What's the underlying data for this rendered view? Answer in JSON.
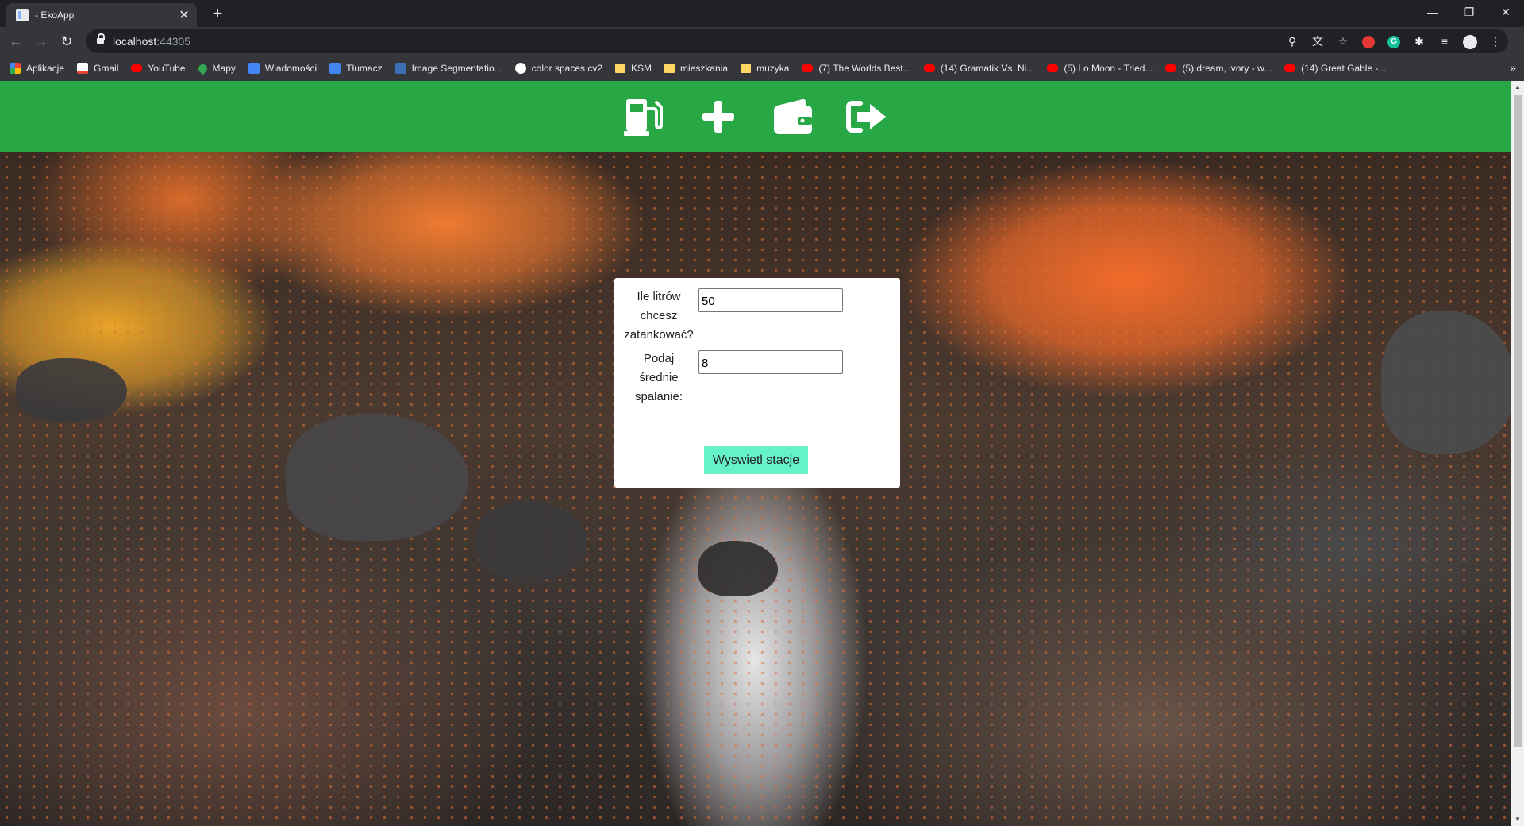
{
  "browser": {
    "tab_title": "- EkoApp",
    "tab_close": "✕",
    "new_tab": "+",
    "url_host": "localhost",
    "url_port": ":44305",
    "window_controls": {
      "minimize": "—",
      "restore": "❐",
      "close": "✕"
    },
    "nav": {
      "back": "←",
      "forward": "→",
      "reload": "↻"
    },
    "omnibox_icons": {
      "location": "⚲",
      "translate": "文",
      "star": "☆",
      "grammarly": "G",
      "puzzle": "✱",
      "media": "≡",
      "menu": "⋮"
    },
    "bookmarks": [
      {
        "label": "Aplikacje",
        "icon": "apps"
      },
      {
        "label": "Gmail",
        "icon": "gmail"
      },
      {
        "label": "YouTube",
        "icon": "yt"
      },
      {
        "label": "Mapy",
        "icon": "maps"
      },
      {
        "label": "Wiadomości",
        "icon": "news"
      },
      {
        "label": "Tłumacz",
        "icon": "translate"
      },
      {
        "label": "Image Segmentatio...",
        "icon": "seg"
      },
      {
        "label": "color spaces cv2",
        "icon": "cs"
      },
      {
        "label": "KSM",
        "icon": "folder"
      },
      {
        "label": "mieszkania",
        "icon": "folder"
      },
      {
        "label": "muzyka",
        "icon": "folder"
      },
      {
        "label": "(7) The Worlds Best...",
        "icon": "yt"
      },
      {
        "label": "(14) Gramatik Vs. Ni...",
        "icon": "yt"
      },
      {
        "label": "(5) Lo Moon - Tried...",
        "icon": "yt"
      },
      {
        "label": "(5) dream, ivory - w...",
        "icon": "yt"
      },
      {
        "label": "(14) Great Gable -...",
        "icon": "yt"
      }
    ],
    "bookmarks_more": "»"
  },
  "app": {
    "header_color": "#28a745",
    "nav_icons": [
      "gas-pump-icon",
      "plus-icon",
      "wallet-icon",
      "sign-out-icon"
    ]
  },
  "form": {
    "liters_label": "Ile litrów chcesz zatankować?",
    "liters_value": "50",
    "consumption_label": "Podaj średnie spalanie:",
    "consumption_value": "8",
    "submit_label": "Wyswietl stacje",
    "submit_color": "#66f2c8"
  }
}
